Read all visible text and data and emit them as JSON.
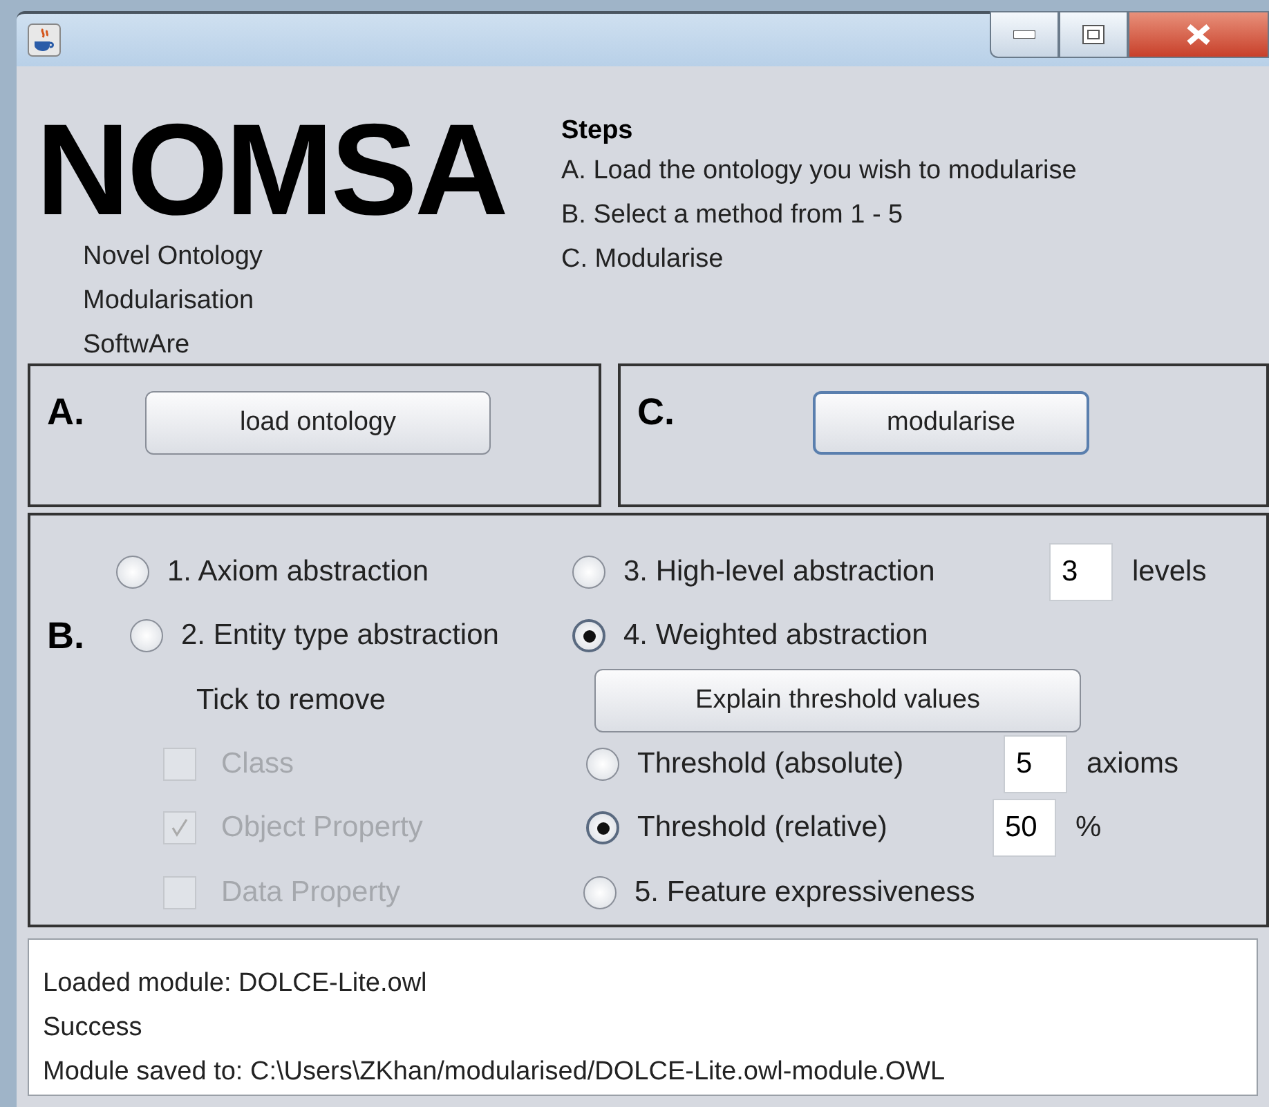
{
  "logo": {
    "title": "NOMSA",
    "subtitle": [
      "Novel Ontology",
      "Modularisation",
      "SoftwAre"
    ]
  },
  "steps": {
    "heading": "Steps",
    "items": [
      "A. Load the ontology you wish to modularise",
      "B. Select a method from 1 - 5",
      "C. Modularise"
    ]
  },
  "panel_a": {
    "label": "A.",
    "button": "load ontology"
  },
  "panel_c": {
    "label": "C.",
    "button": "modularise"
  },
  "panel_b": {
    "label": "B.",
    "methods": [
      {
        "label": "1. Axiom abstraction",
        "selected": false
      },
      {
        "label": "2. Entity type abstraction",
        "selected": false
      },
      {
        "label": "3. High-level abstraction",
        "selected": false,
        "value": "3",
        "unit": "levels"
      },
      {
        "label": "4. Weighted abstraction",
        "selected": true
      },
      {
        "label": "5. Feature expressiveness",
        "selected": false
      }
    ],
    "tick_label": "Tick to remove",
    "checkboxes": [
      {
        "label": "Class",
        "checked": false,
        "disabled": true
      },
      {
        "label": "Object Property",
        "checked": true,
        "disabled": true
      },
      {
        "label": "Data Property",
        "checked": false,
        "disabled": true
      }
    ],
    "explain_button": "Explain threshold values",
    "thresholds": [
      {
        "label": "Threshold (absolute)",
        "selected": false,
        "value": "5",
        "unit": "axioms"
      },
      {
        "label": "Threshold (relative)",
        "selected": true,
        "value": "50",
        "unit": "%"
      }
    ]
  },
  "log": [
    "Loaded module: DOLCE-Lite.owl",
    "Success",
    "Module saved to: C:\\Users\\ZKhan/modularised/DOLCE-Lite.owl-module.OWL"
  ]
}
